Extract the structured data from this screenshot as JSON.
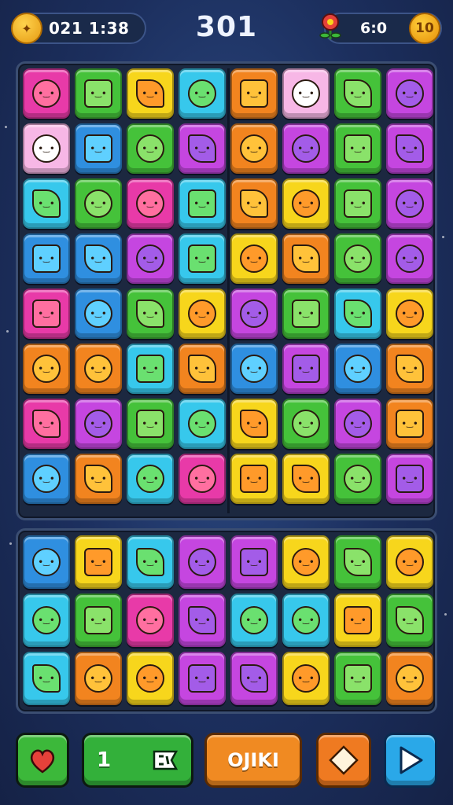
{
  "hud": {
    "timer": "021 1:38",
    "score": "301",
    "right_value": "6:0",
    "right_badge": "10",
    "coin_icon": "wand-coin-icon",
    "flower_icon": "flower-icon"
  },
  "colors": {
    "pink": "#e83aa8",
    "green": "#45c23a",
    "yellow": "#f7d61c",
    "cyan": "#37c8ec",
    "orange": "#f2841f",
    "purple": "#c546e0",
    "blue": "#2f8fe0",
    "lightpink": "#f7b7e6",
    "red": "#e5413a"
  },
  "board_top": [
    [
      "pink",
      "green",
      "yellow",
      "cyan",
      "orange",
      "lightpink",
      "green",
      "purple"
    ],
    [
      "lightpink",
      "blue",
      "green",
      "purple",
      "orange",
      "purple",
      "green",
      "purple"
    ],
    [
      "cyan",
      "green",
      "pink",
      "cyan",
      "orange",
      "yellow",
      "green",
      "purple"
    ],
    [
      "blue",
      "blue",
      "purple",
      "cyan",
      "yellow",
      "orange",
      "green",
      "purple"
    ],
    [
      "pink",
      "blue",
      "green",
      "yellow",
      "purple",
      "green",
      "cyan",
      "yellow"
    ],
    [
      "orange",
      "orange",
      "cyan",
      "orange",
      "blue",
      "purple",
      "blue",
      "orange"
    ],
    [
      "pink",
      "purple",
      "green",
      "cyan",
      "yellow",
      "green",
      "purple",
      "orange"
    ],
    [
      "blue",
      "orange",
      "cyan",
      "pink",
      "yellow",
      "yellow",
      "green",
      "purple"
    ]
  ],
  "board_bottom": [
    [
      "blue",
      "yellow",
      "cyan",
      "purple",
      "purple",
      "yellow",
      "green",
      "yellow"
    ],
    [
      "cyan",
      "green",
      "pink",
      "purple",
      "cyan",
      "cyan",
      "yellow",
      "green"
    ],
    [
      "cyan",
      "orange",
      "yellow",
      "purple",
      "purple",
      "yellow",
      "green",
      "orange"
    ]
  ],
  "controls": {
    "level_value": "1",
    "level_icon": "flag-icon",
    "action_label": "OJIKI",
    "heart_icon": "heart-icon",
    "diamond_icon": "diamond-icon",
    "play_icon": "play-icon"
  }
}
